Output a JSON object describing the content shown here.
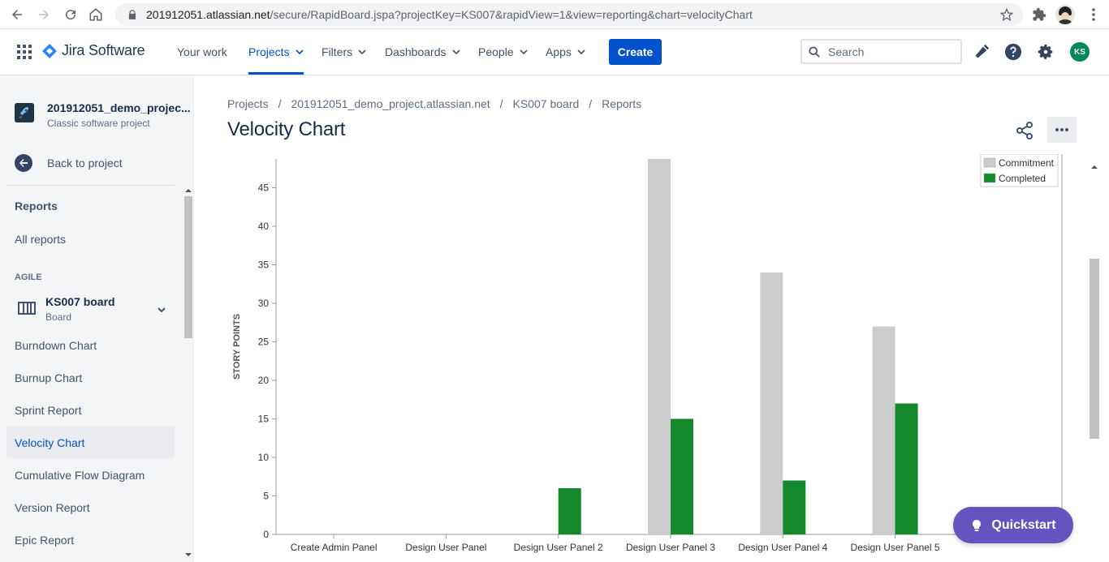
{
  "browser": {
    "url_host": "201912051.atlassian.net",
    "url_path": "/secure/RapidBoard.jspa?projectKey=KS007&rapidView=1&view=reporting&chart=velocityChart"
  },
  "topnav": {
    "product": "Jira Software",
    "items": [
      {
        "label": "Your work",
        "dropdown": false,
        "active": false
      },
      {
        "label": "Projects",
        "dropdown": true,
        "active": true
      },
      {
        "label": "Filters",
        "dropdown": true,
        "active": false
      },
      {
        "label": "Dashboards",
        "dropdown": true,
        "active": false
      },
      {
        "label": "People",
        "dropdown": true,
        "active": false
      },
      {
        "label": "Apps",
        "dropdown": true,
        "active": false
      }
    ],
    "create_label": "Create",
    "search_placeholder": "Search",
    "user_initials": "KS",
    "accent": "#0052cc"
  },
  "sidebar": {
    "project_name": "201912051_demo_projec...",
    "project_type": "Classic software project",
    "back_label": "Back to project",
    "reports_heading": "Reports",
    "all_reports": "All reports",
    "agile_label": "AGILE",
    "board_name": "KS007 board",
    "board_sub": "Board",
    "reports": [
      "Burndown Chart",
      "Burnup Chart",
      "Sprint Report",
      "Velocity Chart",
      "Cumulative Flow Diagram",
      "Version Report",
      "Epic Report"
    ],
    "active_report": "Velocity Chart"
  },
  "main": {
    "breadcrumb": [
      "Projects",
      "201912051_demo_project.atlassian.net",
      "KS007 board",
      "Reports"
    ],
    "title": "Velocity Chart"
  },
  "quickstart_label": "Quickstart",
  "chart_data": {
    "type": "bar",
    "ylabel": "STORY POINTS",
    "yticks": [
      0,
      5,
      10,
      15,
      20,
      25,
      30,
      35,
      40,
      45
    ],
    "ylim": [
      0,
      49
    ],
    "categories": [
      "Create Admin Panel",
      "Design User Panel",
      "Design User Panel 2",
      "Design User Panel 3",
      "Design User Panel 4",
      "Design User Panel 5"
    ],
    "series": [
      {
        "name": "Commitment",
        "color": "#cccccc",
        "values": [
          0,
          0,
          0,
          49,
          34,
          27
        ]
      },
      {
        "name": "Completed",
        "color": "#14892c",
        "values": [
          0,
          0,
          6,
          15,
          7,
          17
        ]
      }
    ],
    "legend": "top-right"
  }
}
